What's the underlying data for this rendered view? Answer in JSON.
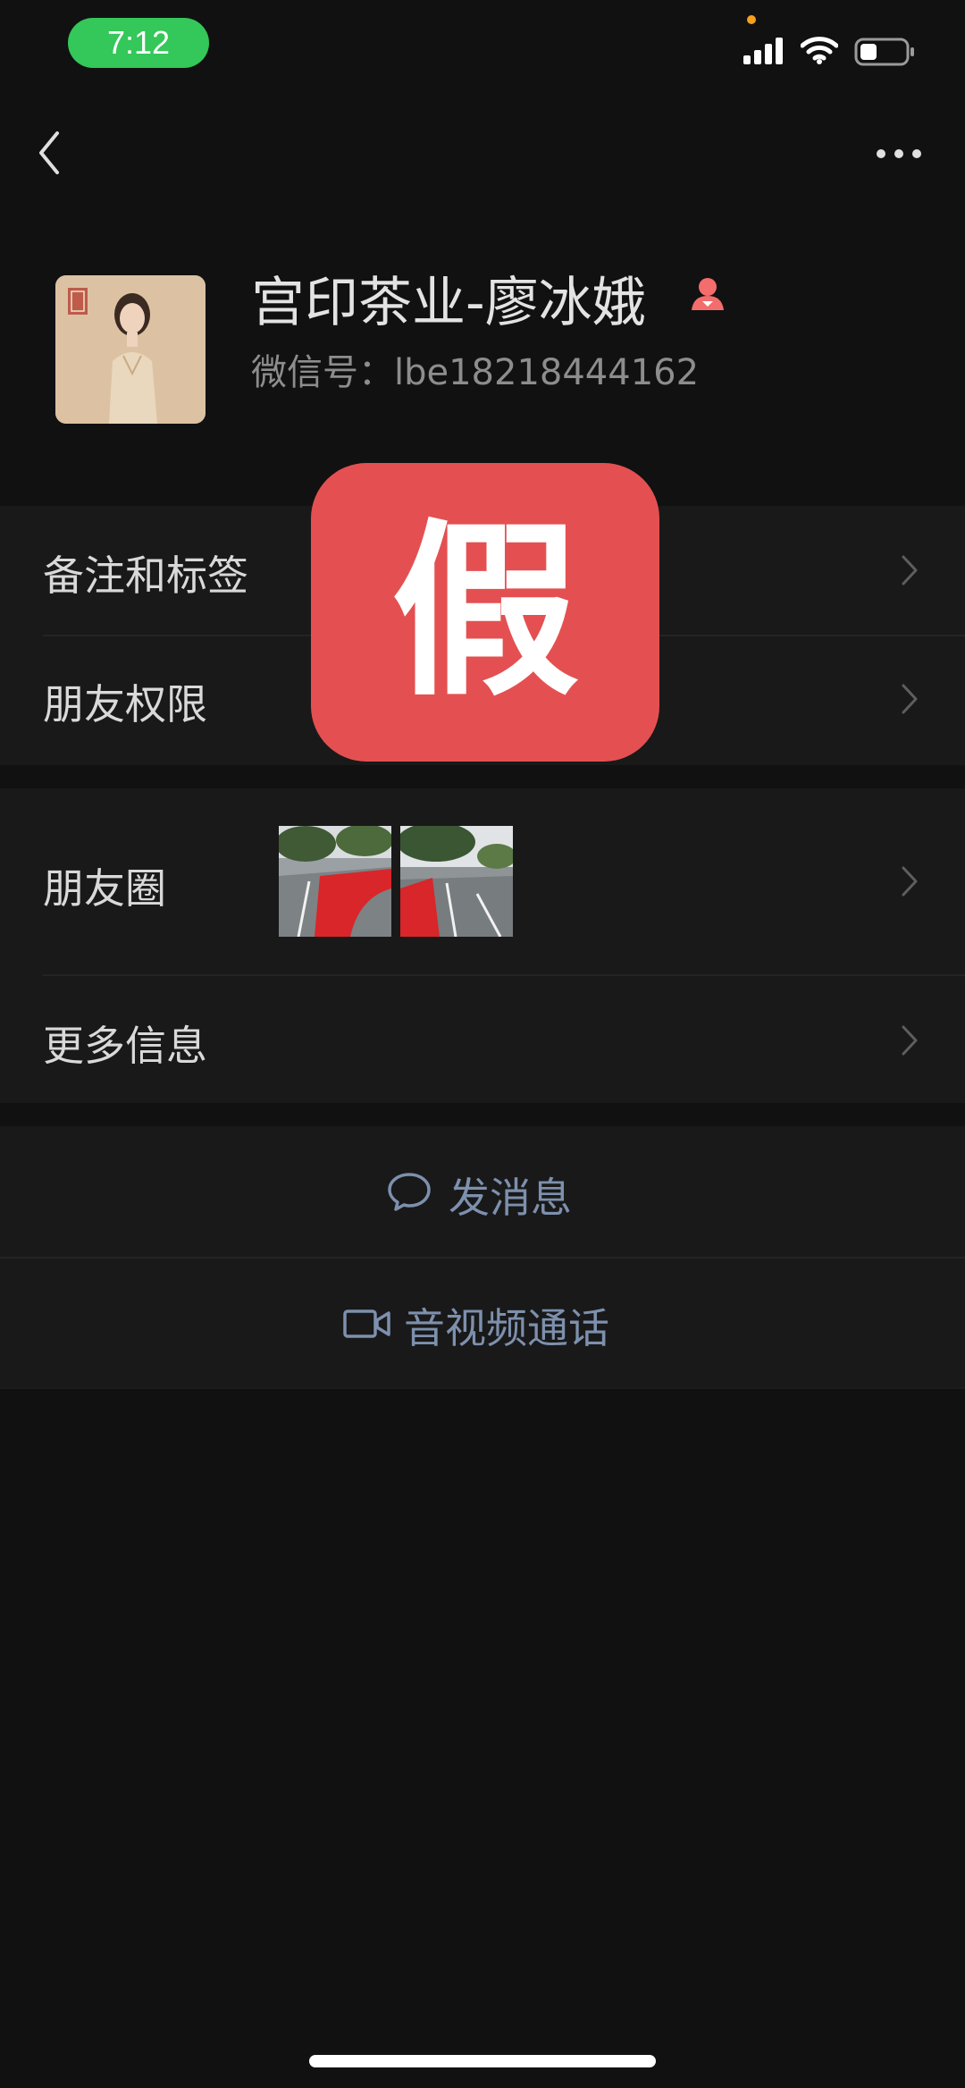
{
  "status_bar": {
    "time": "7:12"
  },
  "nav": {
    "back_icon": "chevron-left-icon",
    "more_icon": "ellipsis-icon"
  },
  "profile": {
    "name": "宫印茶业-廖冰娥",
    "wechat_id": "微信号：lbe18218444162",
    "gender_icon": "female-icon"
  },
  "menu": {
    "group1": [
      "备注和标签",
      "朋友权限"
    ],
    "moments_label": "朋友圈",
    "more_info_label": "更多信息"
  },
  "actions": {
    "send_message": "发消息",
    "video_call": "音视频通话"
  },
  "overlay": {
    "stamp_text": "假"
  },
  "colors": {
    "background": "#111111",
    "cell": "#191919",
    "action_text": "#7d90ad",
    "stamp": "#e45051",
    "time_pill": "#34c759"
  }
}
